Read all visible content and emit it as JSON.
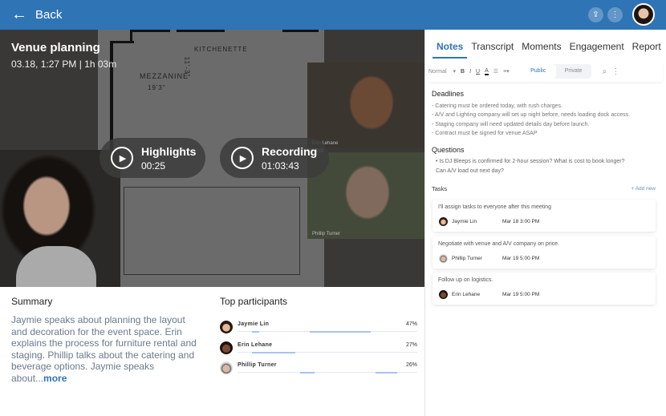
{
  "header": {
    "back_label": "Back",
    "share_icon": "share-icon",
    "more_icon": "more-vertical-icon"
  },
  "video": {
    "title": "Venue planning",
    "meta": "03.18, 1:27 PM | 1h 03m",
    "floorplan": {
      "labels": [
        "KITCHENETTE",
        "MEZZANINE",
        "19'3\"",
        "11'-3\""
      ]
    },
    "tiles": [
      "Erin Lehane",
      "Phillip Turner"
    ],
    "highlights": {
      "label": "Highlights",
      "time": "00:25"
    },
    "recording": {
      "label": "Recording",
      "time": "01:03:43"
    }
  },
  "summary": {
    "heading": "Summary",
    "text": "Jaymie speaks about planning the layout and decoration for the event space. Erin explains the process for furniture rental and staging. Phillip talks about the catering and beverage options. Jaymie speaks about...",
    "more": "more"
  },
  "participants": {
    "heading": "Top participants",
    "items": [
      {
        "name": "Jaymie Lin",
        "percent": "47%",
        "value": 47
      },
      {
        "name": "Erin Lehane",
        "percent": "27%",
        "value": 27
      },
      {
        "name": "Phillip Turner",
        "percent": "26%",
        "value": 26
      }
    ]
  },
  "tabs": [
    "Notes",
    "Transcript",
    "Moments",
    "Engagement",
    "Report"
  ],
  "active_tab": "Notes",
  "toolbar": {
    "style": "Normal",
    "bold": "B",
    "italic": "I",
    "underline": "U",
    "color": "A",
    "public": "Public",
    "private": "Private",
    "selected_visibility": "Public"
  },
  "notes": {
    "deadlines": {
      "heading": "Deadlines",
      "items": [
        "- Catering must be ordered today, with rush charges.",
        "- A/V and Lighting company will set up night before, needs loading dock access.",
        "- Staging company will need updated details day before launch.",
        "- Contract must be signed for venue ASAP"
      ]
    },
    "questions": {
      "heading": "Questions",
      "items": [
        "Is DJ Bleeps is confirmed for 2-hour session? What is cost to book longer?",
        "Can A/V load out next day?"
      ]
    }
  },
  "tasks": {
    "heading": "Tasks",
    "add_label": "+ Add new",
    "items": [
      {
        "text": "I'll assign tasks to everyone after this meeting",
        "assignee": "Jaymie Lin",
        "due": "Mar 18   3:00 PM"
      },
      {
        "text": "Negotiate with venue and A/V company on price.",
        "assignee": "Phillip Turner",
        "due": "Mar 19   5:00 PM"
      },
      {
        "text": "Follow up on logistics.",
        "assignee": "Erin Lehane",
        "due": "Mar 19   5:00 PM"
      }
    ]
  }
}
